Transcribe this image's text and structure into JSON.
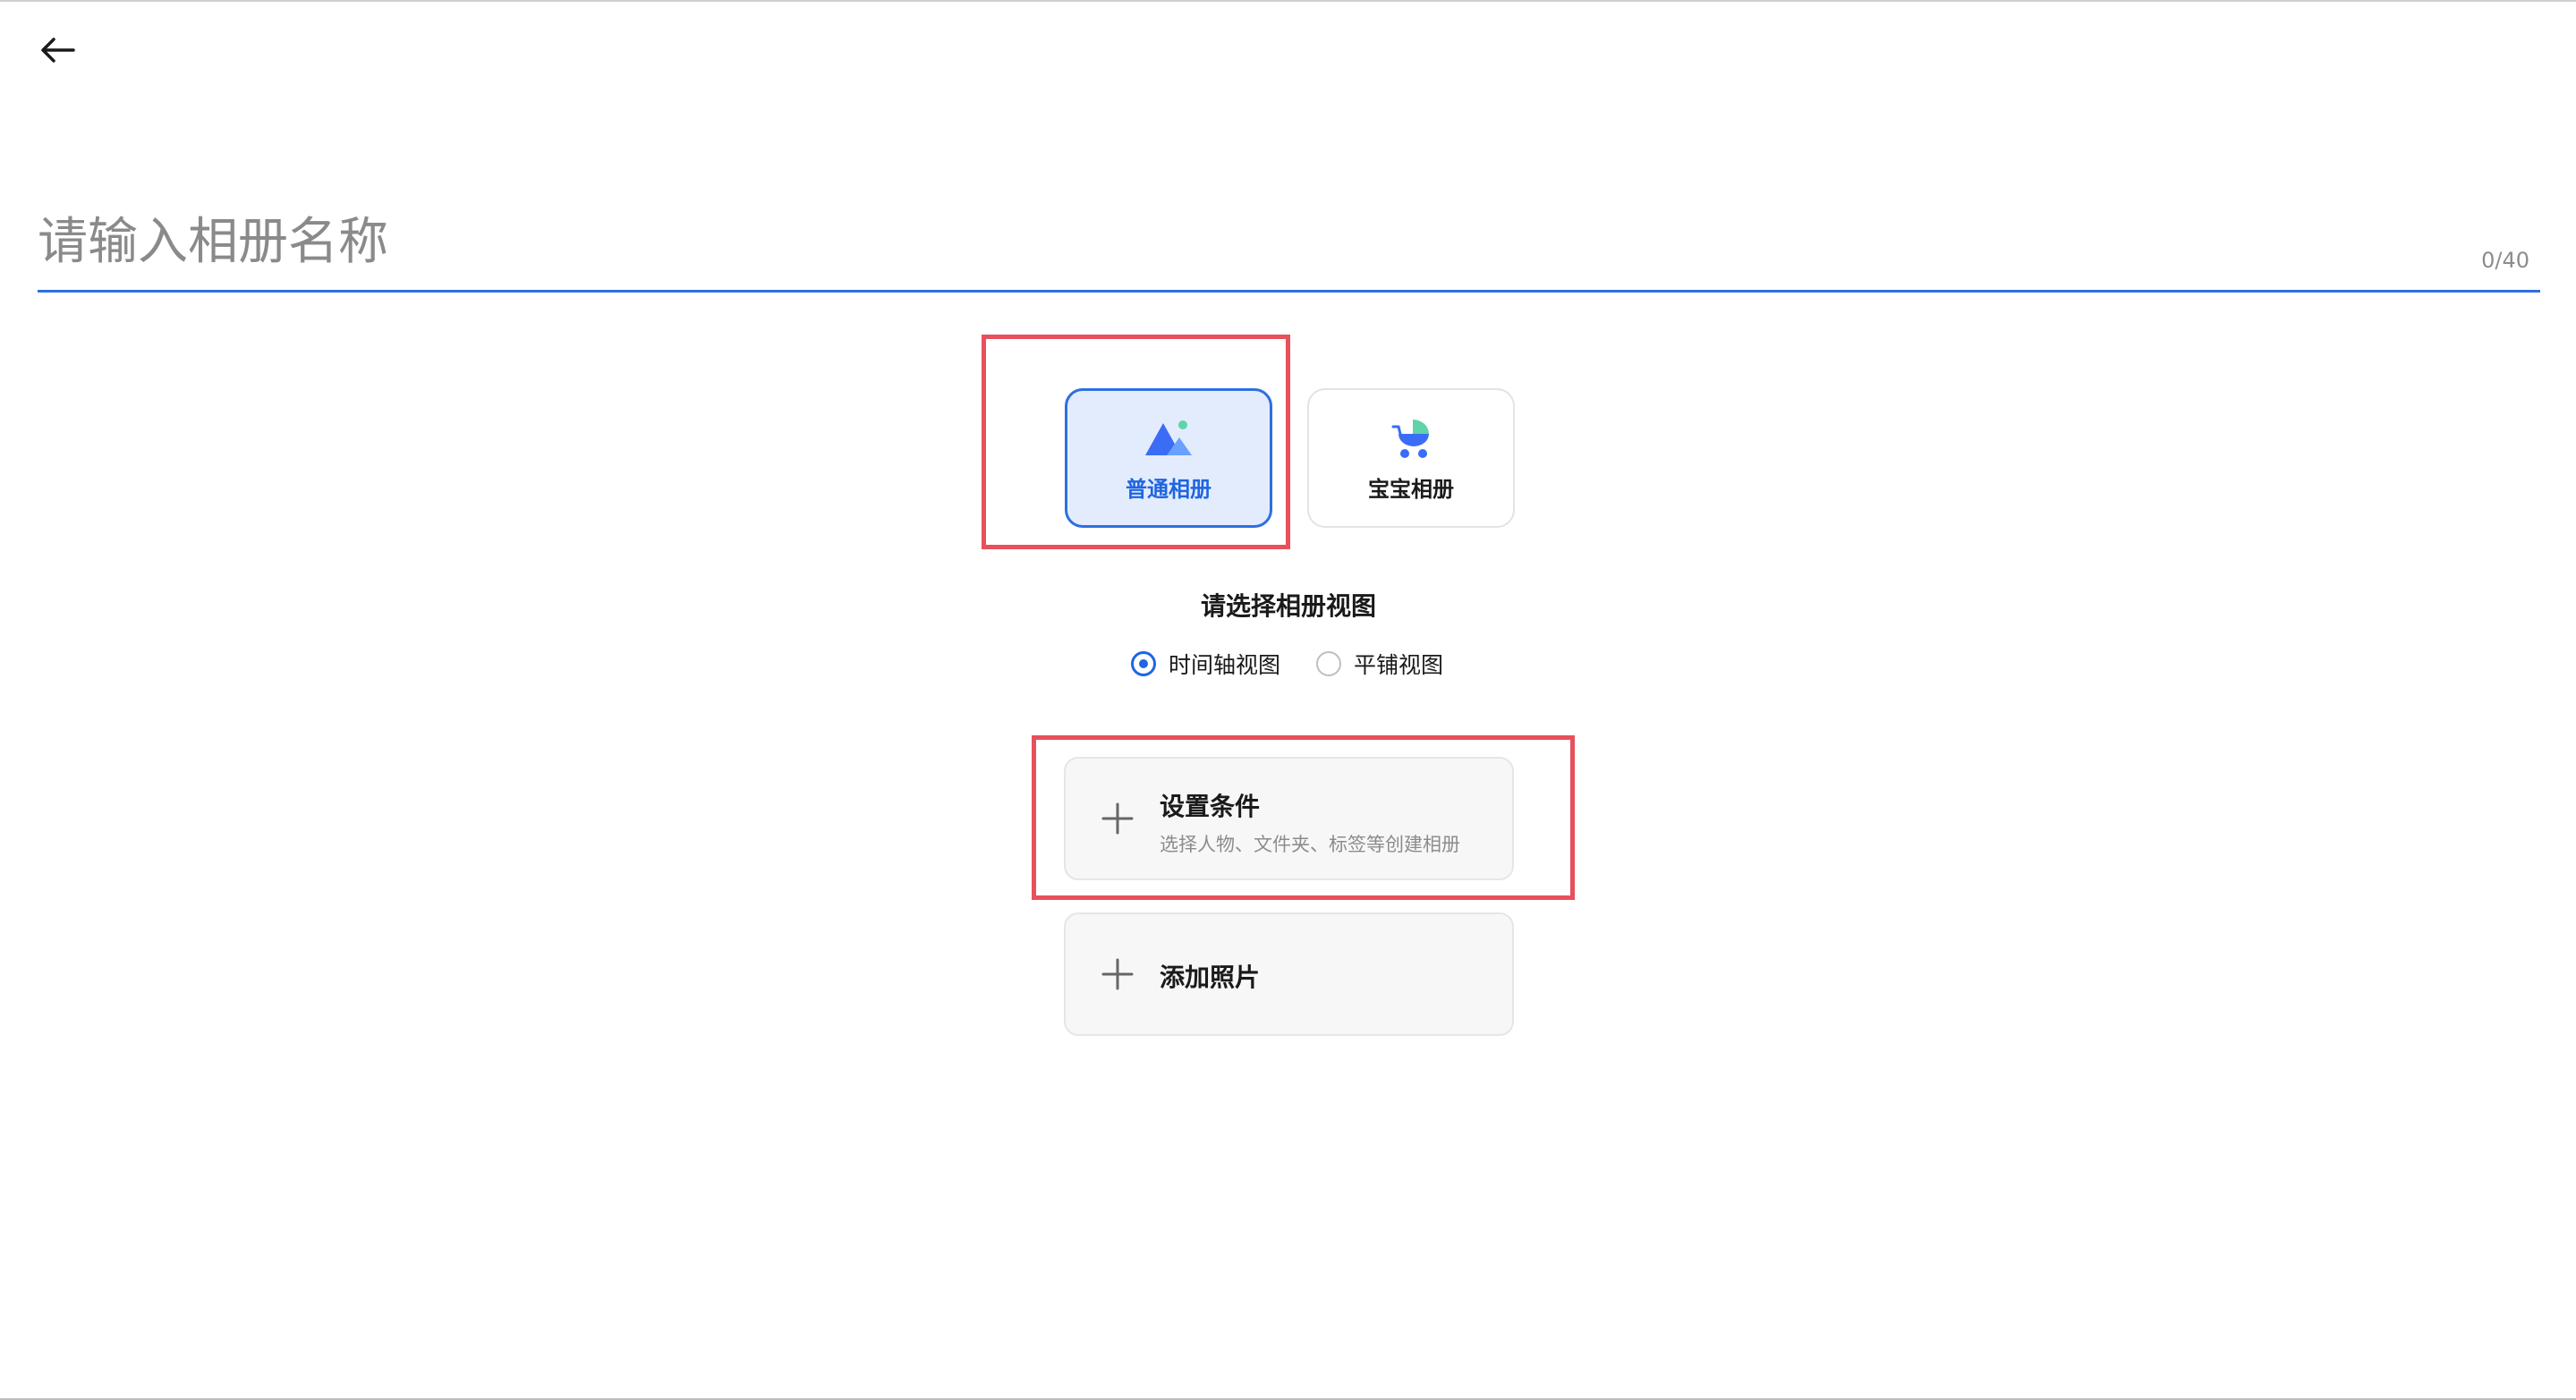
{
  "header": {
    "back_icon": "arrow-left-icon"
  },
  "name_input": {
    "placeholder": "请输入相册名称",
    "value": "",
    "counter": "0/40"
  },
  "album_types": {
    "selected": "普通相册",
    "items": [
      {
        "label": "普通相册",
        "icon": "mountain-photo-icon",
        "selected": true
      },
      {
        "label": "宝宝相册",
        "icon": "baby-stroller-icon",
        "selected": false
      }
    ]
  },
  "view_selection": {
    "title": "请选择相册视图",
    "options": [
      {
        "label": "时间轴视图",
        "checked": true
      },
      {
        "label": "平铺视图",
        "checked": false
      }
    ]
  },
  "actions": {
    "conditions": {
      "title": "设置条件",
      "subtitle": "选择人物、文件夹、标签等创建相册",
      "icon": "plus-icon"
    },
    "photos": {
      "title": "添加照片",
      "icon": "plus-icon"
    }
  },
  "colors": {
    "accent": "#1f66e0",
    "selected_card_bg": "#e3ecfd",
    "highlight": "#e8505b"
  }
}
